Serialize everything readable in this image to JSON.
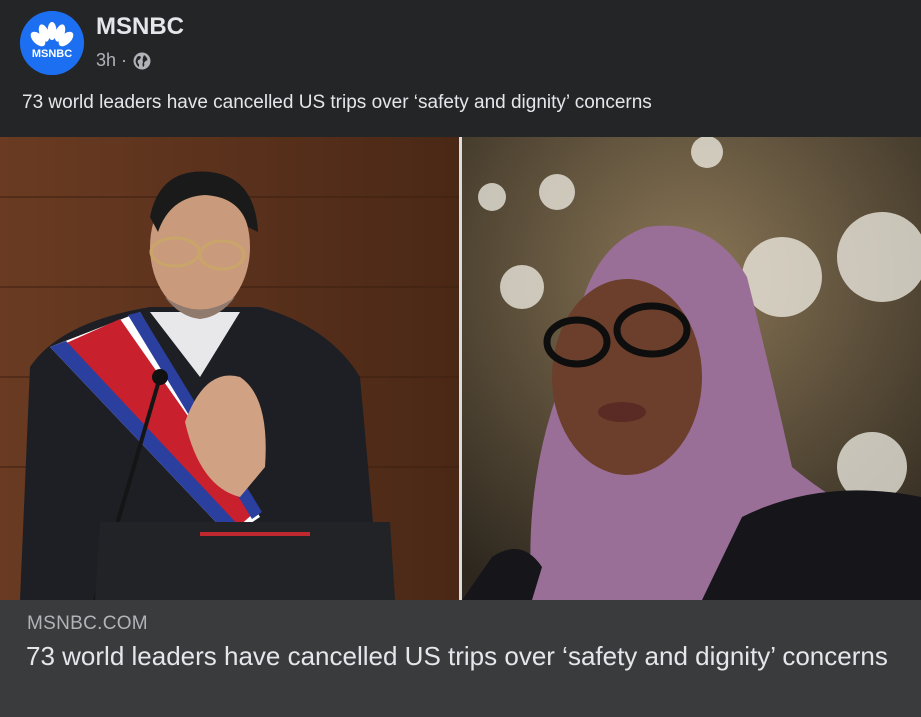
{
  "post": {
    "page_name": "MSNBC",
    "timestamp": "3h",
    "separator": "·",
    "privacy_icon": "globe-icon",
    "caption": "73 world leaders have cancelled US trips over ‘safety and dignity’ concerns",
    "avatar_text": "MSNBC"
  },
  "link_preview": {
    "domain": "MSNBC.COM",
    "title": "73 world leaders have cancelled US trips over ‘safety and dignity’ concerns"
  },
  "colors": {
    "background": "#242526",
    "card": "#3a3b3c",
    "brand_blue": "#1d6ff2"
  }
}
